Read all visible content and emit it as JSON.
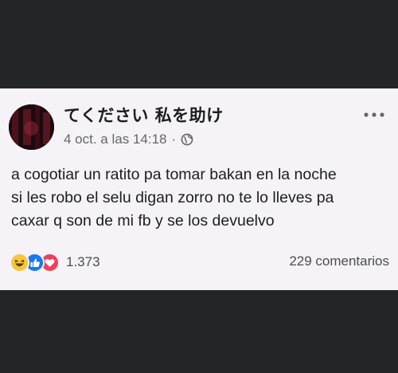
{
  "post": {
    "author": "てください 私を助け",
    "date": "4 oct. a las 14:18",
    "separator": "·",
    "privacy_icon": "globe-icon",
    "more_icon": "more-horizontal-icon",
    "text_lines": [
      "a cogotiar un ratito pa tomar bakan en la noche",
      "si les robo el selu digan zorro no te lo lleves pa",
      "caxar q son de mi fb y se los devuelvo"
    ],
    "reactions": {
      "icons": [
        "haha-icon",
        "like-icon",
        "love-icon"
      ],
      "count": "1.373"
    },
    "comments": "229 comentarios"
  },
  "colors": {
    "card_background": "#f5f3f7",
    "page_background": "#232527",
    "like_blue": "#1877f2",
    "love_red": "#f33e58",
    "haha_yellow": "#f7c63b"
  }
}
